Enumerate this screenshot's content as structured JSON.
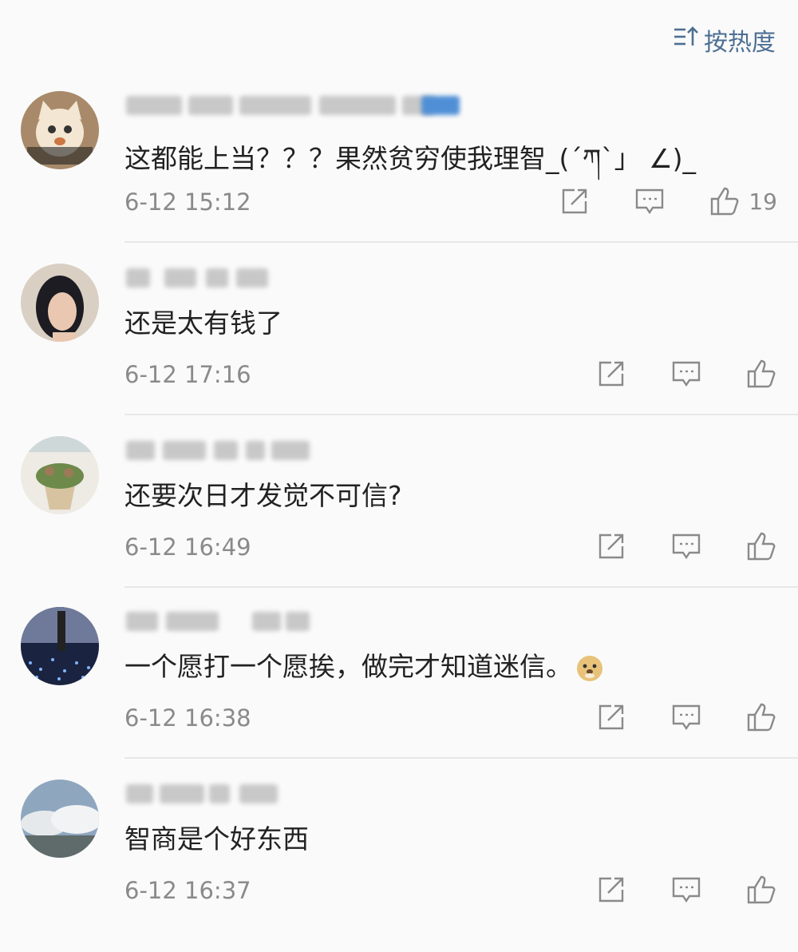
{
  "header": {
    "sort_label": "按热度",
    "sort_icon": "sort-descending-icon"
  },
  "colors": {
    "accent": "#4d6f93",
    "muted": "#8a8a8a",
    "text": "#222222",
    "background": "#fafafa"
  },
  "comments": [
    {
      "content": "这都能上当？？？果然贫穷使我理智_(´ཀ`」 ∠)_",
      "time": "6-12 15:12",
      "likes": "19",
      "avatar": "cat-avatar"
    },
    {
      "content": "还是太有钱了",
      "time": "6-12 17:16",
      "likes": "",
      "avatar": "girl-avatar"
    },
    {
      "content": "还要次日才发觉不可信?",
      "time": "6-12 16:49",
      "likes": "",
      "avatar": "plant-avatar"
    },
    {
      "content": "一个愿打一个愿挨，做完才知道迷信。",
      "time": "6-12 16:38",
      "likes": "",
      "avatar": "city-lights-avatar",
      "emoji": "doge-emoji"
    },
    {
      "content": "智商是个好东西",
      "time": "6-12 16:37",
      "likes": "",
      "avatar": "mountain-clouds-avatar"
    }
  ]
}
